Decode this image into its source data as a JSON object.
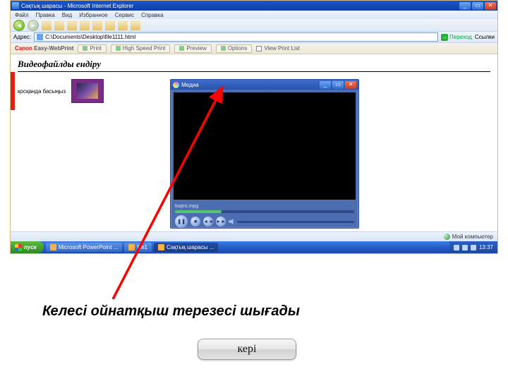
{
  "browser": {
    "window_title": "Сақтық шарасы - Microsoft Internet Explorer",
    "menu": [
      "Файл",
      "Правка",
      "Вид",
      "Избранное",
      "Сервис",
      "Справка"
    ],
    "address_label": "Адрес:",
    "address_value": "C:\\Documents\\Desktop\\file1111.html",
    "go_label": "Переход",
    "links_label": "Ссылки",
    "status_zone": "Мой компьютер"
  },
  "printbar": {
    "brand_plain": "Canon",
    "brand_suffix": " Easy-WebPrint",
    "buttons": {
      "print": "Print",
      "hsprint": "High Speed Print",
      "preview": "Preview",
      "options": "Options",
      "viewlist": "View Print List"
    }
  },
  "page": {
    "heading": "Видеофайлды ендіру",
    "thumb_caption": "қосқанда басыңыз"
  },
  "player": {
    "title": "Медиа",
    "file": "kopro.mpg",
    "duration_symbol": "·"
  },
  "taskbar": {
    "start": "пуск",
    "tasks": [
      "Microsoft PowerPoint ...",
      "file1",
      "Сақтық шарасы ..."
    ],
    "clock": "13:37"
  },
  "annotation": {
    "caption": "Келесі ойнатқыш терезесі шығады",
    "back_btn": "кері"
  }
}
